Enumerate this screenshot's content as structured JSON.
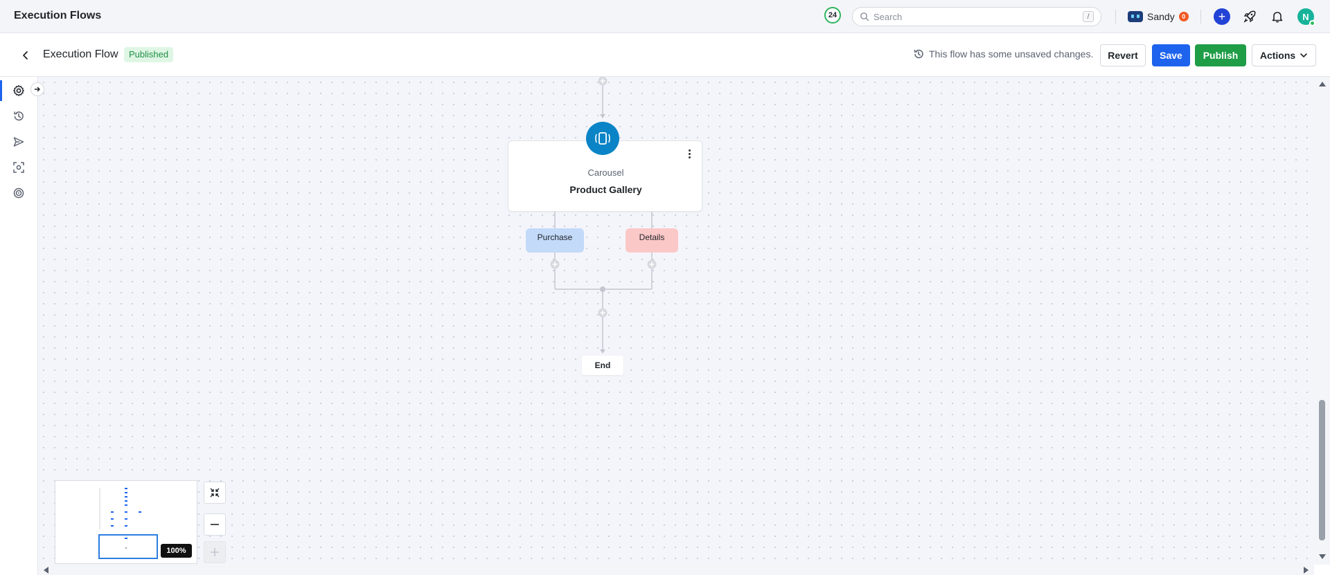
{
  "topbar": {
    "app_title": "Execution Flows",
    "count_badge": "24",
    "search_placeholder": "Search",
    "search_shortcut": "/",
    "user_name": "Sandy",
    "user_notifications": "0",
    "avatar_initial": "N"
  },
  "subbar": {
    "flow_title": "Execution Flow",
    "status_badge": "Published",
    "unsaved_message": "This flow has some unsaved changes.",
    "revert_label": "Revert",
    "save_label": "Save",
    "publish_label": "Publish",
    "actions_label": "Actions"
  },
  "rail": {
    "items": [
      "gear-icon",
      "history-icon",
      "send-icon",
      "scan-icon",
      "target-icon"
    ]
  },
  "flow": {
    "node": {
      "type": "Carousel",
      "name": "Product Gallery",
      "icon": "carousel-icon",
      "color": "#0a84c6"
    },
    "branches": [
      {
        "label": "Purchase",
        "color": "#c3daf9"
      },
      {
        "label": "Details",
        "color": "#fbc8c8"
      }
    ],
    "end_label": "End"
  },
  "controls": {
    "zoom_level": "100%"
  },
  "colors": {
    "accent_blue": "#1d63ed",
    "publish_green": "#1f9d47",
    "published_badge_bg": "#dff6e5"
  }
}
